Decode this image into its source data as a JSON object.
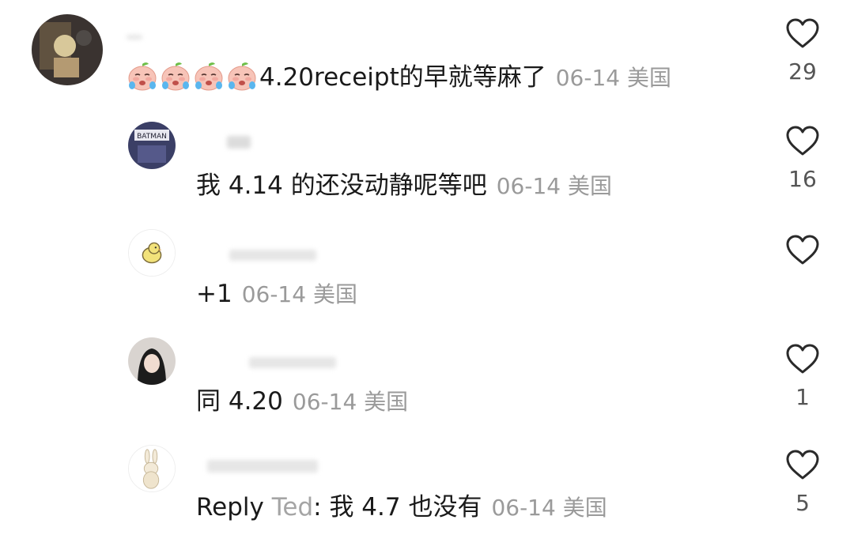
{
  "comments": [
    {
      "text": "4.20receipt的早就等麻了",
      "date": "06-14",
      "location": "美国",
      "likes": "29",
      "emoji": "crying-peach-face",
      "emoji_count": 4
    },
    {
      "text": "我 4.14 的还没动静呢等吧",
      "date": "06-14",
      "location": "美国",
      "likes": "16",
      "avatar_text": "BATMAN"
    },
    {
      "text": "+1",
      "date": "06-14",
      "location": "美国",
      "likes": ""
    },
    {
      "text": "同 4.20",
      "date": "06-14",
      "location": "美国",
      "likes": "1"
    },
    {
      "reply_prefix": "Reply",
      "reply_to": "Ted",
      "text": ": 我 4.7 也没有",
      "date": "06-14",
      "location": "美国",
      "likes": "5"
    }
  ],
  "icons": {
    "like": "heart-outline-icon"
  },
  "colors": {
    "text": "#1a1a1a",
    "meta": "#9a9a9a",
    "reply_name": "#a5a5a5",
    "like_count": "#555555"
  }
}
